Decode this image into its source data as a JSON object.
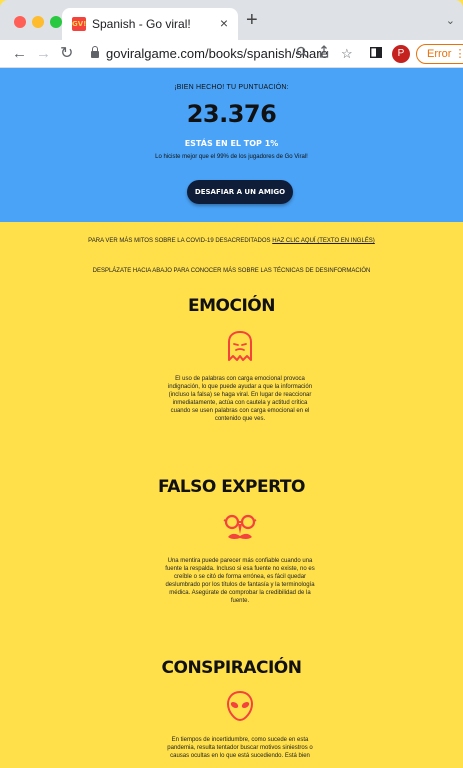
{
  "browser": {
    "tab_title": "Spanish - Go viral!",
    "favicon_text": "GV!",
    "close_glyph": "×",
    "new_tab_glyph": "+",
    "tab_list_glyph": "⌄",
    "url": "goviralgame.com/books/spanish/share",
    "profile_initial": "P",
    "error_label": "Error",
    "error_menu_glyph": "⋮"
  },
  "result": {
    "label": "¡BIEN HECHO! TU PUNTUACIÓN:",
    "score": "23.376",
    "top_text": "ESTÁS EN EL TOP 1%",
    "better_text": "Lo hiciste mejor que el 99% de los jugadores de Go Viral!",
    "challenge_button": "DESAFIAR A UN AMIGO"
  },
  "info": {
    "covid_prefix": "PARA VER MÁS MITOS SOBRE LA COVID-19 DESACREDITADOS",
    "covid_link": "HAZ CLIC AQUÍ (TEXTO EN INGLÉS)",
    "scroll_text": "DESPLÁZATE HACIA ABAJO PARA CONOCER MÁS SOBRE LAS TÉCNICAS DE DESINFORMACIÓN"
  },
  "sections": [
    {
      "title": "EMOCIÓN",
      "icon": "ghost-icon",
      "text": "El uso de palabras con carga emocional provoca indignación, lo que puede ayudar a que la información (incluso la falsa) se haga viral. En lugar de reaccionar inmediatamente, actúa con cautela y actitud crítica cuando se usen palabras con carga emocional en el contenido que ves."
    },
    {
      "title": "FALSO EXPERTO",
      "icon": "disguise-glasses-icon",
      "text": "Una mentira puede parecer más confiable cuando una fuente la respalda. Incluso si esa fuente no existe, no es creíble o se citó de forma errónea, es fácil quedar deslumbrado por los títulos de fantasía y la terminología médica. Asegúrate de comprobar la credibilidad de la fuente."
    },
    {
      "title": "CONSPIRACIÓN",
      "icon": "alien-icon",
      "text": "En tiempos de incertidumbre, como sucede en esta pandemia, resulta tentador buscar motivos siniestros o causas ocultas en lo que está sucediendo. Está bien"
    }
  ],
  "colors": {
    "hero_bg": "#4aa3f7",
    "page_bg": "#ffe04b",
    "button_bg": "#0f1d38",
    "icon_red": "#f4433c"
  }
}
